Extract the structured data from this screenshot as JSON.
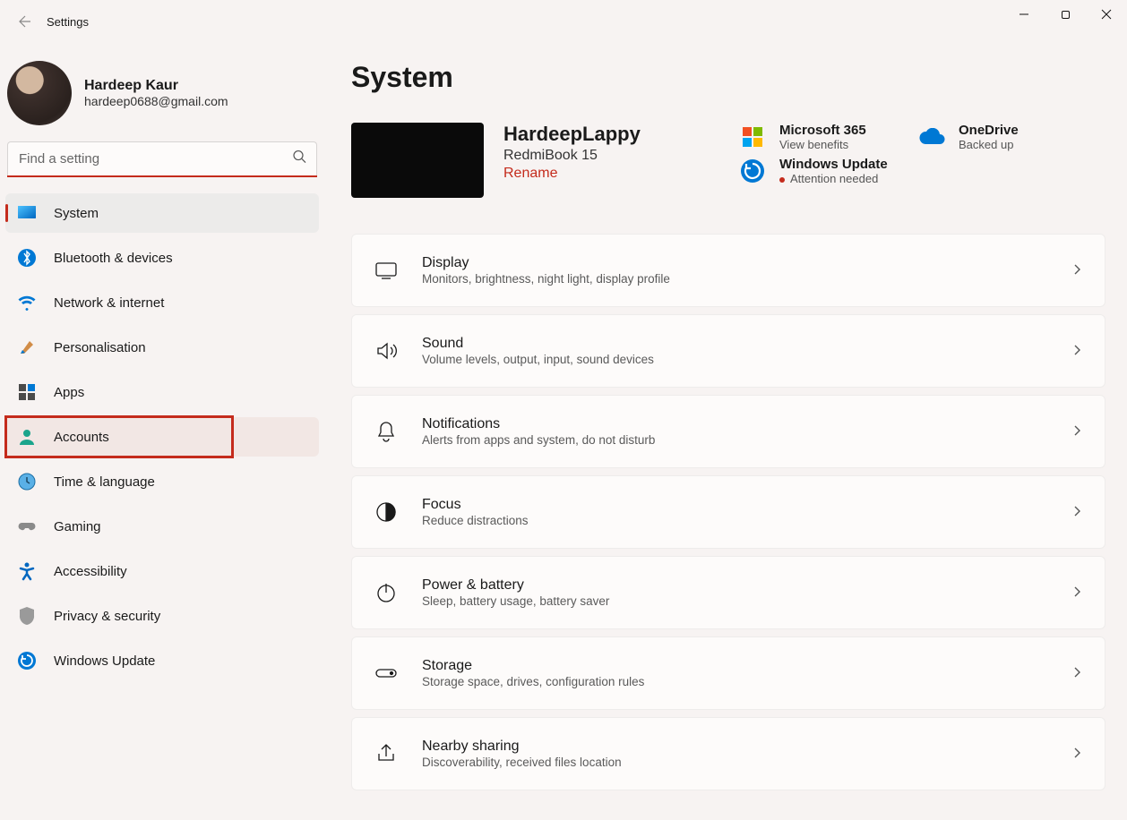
{
  "window": {
    "title": "Settings"
  },
  "profile": {
    "name": "Hardeep Kaur",
    "email": "hardeep0688@gmail.com"
  },
  "search": {
    "placeholder": "Find a setting"
  },
  "nav": [
    {
      "id": "system",
      "label": "System",
      "active": true
    },
    {
      "id": "bluetooth",
      "label": "Bluetooth & devices"
    },
    {
      "id": "network",
      "label": "Network & internet"
    },
    {
      "id": "personalisation",
      "label": "Personalisation"
    },
    {
      "id": "apps",
      "label": "Apps"
    },
    {
      "id": "accounts",
      "label": "Accounts",
      "highlighted": true
    },
    {
      "id": "time",
      "label": "Time & language"
    },
    {
      "id": "gaming",
      "label": "Gaming"
    },
    {
      "id": "accessibility",
      "label": "Accessibility"
    },
    {
      "id": "privacy",
      "label": "Privacy & security"
    },
    {
      "id": "update",
      "label": "Windows Update"
    }
  ],
  "page": {
    "title": "System",
    "device": {
      "name": "HardeepLappy",
      "model": "RedmiBook 15",
      "rename_label": "Rename"
    },
    "hero": {
      "m365": {
        "title": "Microsoft 365",
        "sub": "View benefits"
      },
      "onedrive": {
        "title": "OneDrive",
        "sub": "Backed up"
      },
      "update": {
        "title": "Windows Update",
        "sub": "Attention needed"
      }
    },
    "cards": [
      {
        "id": "display",
        "title": "Display",
        "sub": "Monitors, brightness, night light, display profile"
      },
      {
        "id": "sound",
        "title": "Sound",
        "sub": "Volume levels, output, input, sound devices"
      },
      {
        "id": "notifications",
        "title": "Notifications",
        "sub": "Alerts from apps and system, do not disturb"
      },
      {
        "id": "focus",
        "title": "Focus",
        "sub": "Reduce distractions"
      },
      {
        "id": "power",
        "title": "Power & battery",
        "sub": "Sleep, battery usage, battery saver"
      },
      {
        "id": "storage",
        "title": "Storage",
        "sub": "Storage space, drives, configuration rules"
      },
      {
        "id": "nearby",
        "title": "Nearby sharing",
        "sub": "Discoverability, received files location"
      }
    ]
  }
}
